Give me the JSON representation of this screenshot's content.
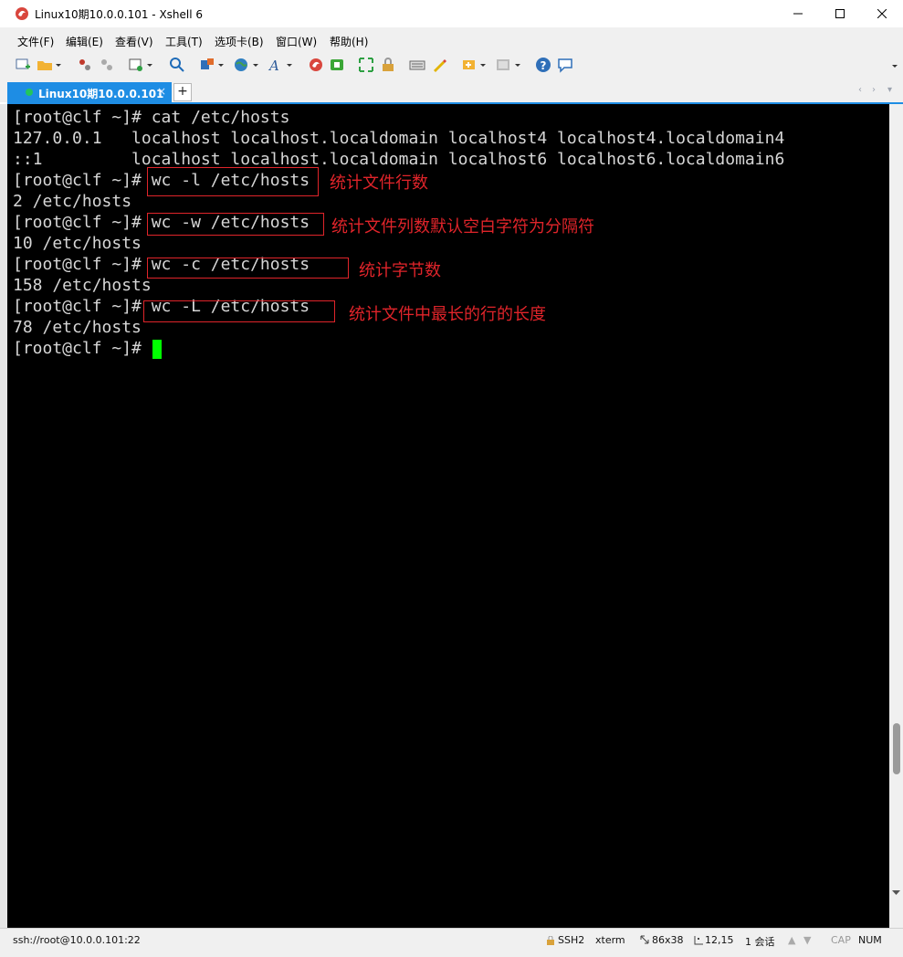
{
  "window": {
    "title": "Linux10期10.0.0.101 - Xshell 6"
  },
  "menu": [
    "文件(F)",
    "编辑(E)",
    "查看(V)",
    "工具(T)",
    "选项卡(B)",
    "窗口(W)",
    "帮助(H)"
  ],
  "tab": {
    "label": "Linux10期10.0.0.101",
    "close": "×",
    "add": "+"
  },
  "terminal": {
    "lines": [
      "[root@clf ~]# cat /etc/hosts",
      "127.0.0.1   localhost localhost.localdomain localhost4 localhost4.localdomain4",
      "::1         localhost localhost.localdomain localhost6 localhost6.localdomain6",
      "[root@clf ~]# wc -l /etc/hosts",
      "2 /etc/hosts",
      "[root@clf ~]# wc -w /etc/hosts",
      "10 /etc/hosts",
      "[root@clf ~]# wc -c /etc/hosts",
      "158 /etc/hosts",
      "[root@clf ~]# wc -L /etc/hosts",
      "78 /etc/hosts",
      "[root@clf ~]# "
    ],
    "annotations": [
      "统计文件行数",
      "统计文件列数默认空白字符为分隔符",
      "统计字节数",
      "统计文件中最长的行的长度"
    ],
    "cursor_color": "#00ff00",
    "annotation_color": "#e0242a"
  },
  "status": {
    "connection": "ssh://root@10.0.0.101:22",
    "protocol": "SSH2",
    "term": "xterm",
    "size": "86x38",
    "pos": "12,15",
    "sessions": "1 会话",
    "cap": "CAP",
    "num": "NUM"
  }
}
